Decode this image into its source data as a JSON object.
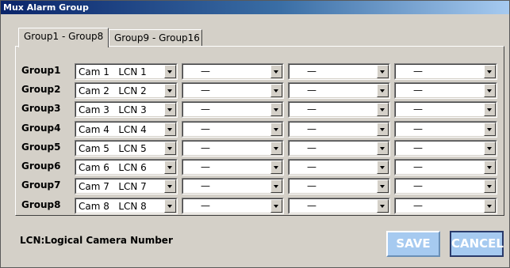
{
  "window": {
    "title": "Mux Alarm Group"
  },
  "tabs": [
    {
      "label": "Group1 - Group8",
      "active": true
    },
    {
      "label": "Group9 - Group16",
      "active": false
    }
  ],
  "groups": [
    {
      "label": "Group1",
      "cam": "Cam 1   LCN 1",
      "slots": [
        "—",
        "—",
        "—"
      ]
    },
    {
      "label": "Group2",
      "cam": "Cam 2   LCN 2",
      "slots": [
        "—",
        "—",
        "—"
      ]
    },
    {
      "label": "Group3",
      "cam": "Cam 3   LCN 3",
      "slots": [
        "—",
        "—",
        "—"
      ]
    },
    {
      "label": "Group4",
      "cam": "Cam 4   LCN 4",
      "slots": [
        "—",
        "—",
        "—"
      ]
    },
    {
      "label": "Group5",
      "cam": "Cam 5   LCN 5",
      "slots": [
        "—",
        "—",
        "—"
      ]
    },
    {
      "label": "Group6",
      "cam": "Cam 6   LCN 6",
      "slots": [
        "—",
        "—",
        "—"
      ]
    },
    {
      "label": "Group7",
      "cam": "Cam 7   LCN 7",
      "slots": [
        "—",
        "—",
        "—"
      ]
    },
    {
      "label": "Group8",
      "cam": "Cam 8   LCN 8",
      "slots": [
        "—",
        "—",
        "—"
      ]
    }
  ],
  "footer": {
    "note": "LCN:Logical Camera Number",
    "save_label": "SAVE",
    "cancel_label": "CANCEL"
  }
}
